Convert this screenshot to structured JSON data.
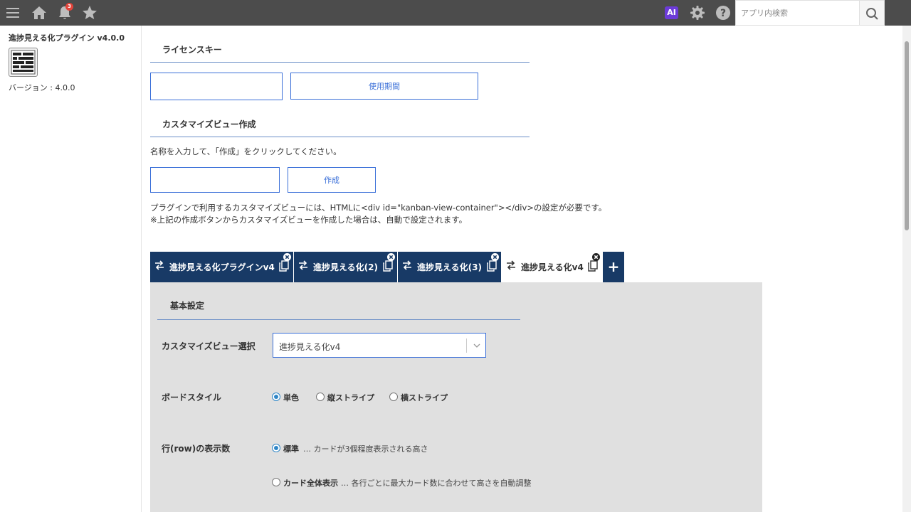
{
  "header": {
    "notification_count": "3",
    "ai_label": "AI",
    "search_placeholder": "アプリ内検索"
  },
  "plugin": {
    "title": "進捗見える化プラグイン v4.0.0",
    "version": "バージョン : 4.0.0"
  },
  "license": {
    "heading": "ライセンスキー",
    "key_value": "",
    "period_button": "使用期間"
  },
  "custom_view": {
    "heading": "カスタマイズビュー作成",
    "instruction": "名称を入力して、「作成」をクリックしてください。",
    "name_value": "",
    "create_button": "作成",
    "note1": "プラグインで利用するカスタマイズビューには、HTMLに<div id=\"kanban-view-container\"></div>の設定が必要です。",
    "note2": "※上記の作成ボタンからカスタマイズビューを作成した場合は、自動で設定されます。"
  },
  "tabs": [
    {
      "label": "進捗見える化プラグインv4",
      "active": false
    },
    {
      "label": "進捗見える化(2)",
      "active": false
    },
    {
      "label": "進捗見える化(3)",
      "active": false
    },
    {
      "label": "進捗見える化v4",
      "active": true
    }
  ],
  "tab_add_label": "+",
  "settings": {
    "heading": "基本設定",
    "view_select_label": "カスタマイズビュー選択",
    "view_select_value": "進捗見える化v4",
    "board_style_label": "ボードスタイル",
    "board_style_options": [
      "単色",
      "縦ストライプ",
      "横ストライプ"
    ],
    "board_style_selected": "単色",
    "row_count_label": "行(row)の表示数",
    "row_count_options": [
      {
        "label": "標準",
        "desc": "… カードが3個程度表示される高さ"
      },
      {
        "label": "カード全体表示",
        "desc": "… 各行ごとに最大カード数に合わせて高さを自動調整"
      }
    ],
    "row_count_selected": "標準"
  },
  "colors": {
    "topbar": "#4c4c4c",
    "tab_dark": "#183a66",
    "accent_blue": "#3a6fd8",
    "panel_gray": "#e0e0e0",
    "radio_blue": "#2f86c7"
  }
}
